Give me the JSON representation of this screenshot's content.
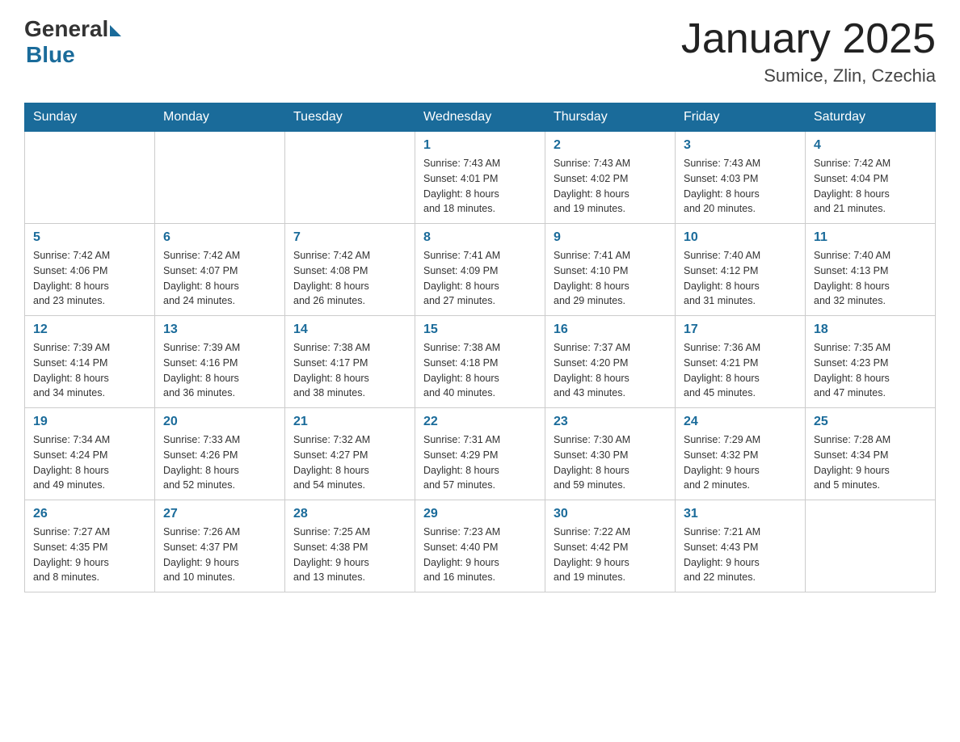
{
  "header": {
    "logo_general": "General",
    "logo_blue": "Blue",
    "month_title": "January 2025",
    "location": "Sumice, Zlin, Czechia"
  },
  "days_of_week": [
    "Sunday",
    "Monday",
    "Tuesday",
    "Wednesday",
    "Thursday",
    "Friday",
    "Saturday"
  ],
  "weeks": [
    [
      {
        "day": "",
        "info": ""
      },
      {
        "day": "",
        "info": ""
      },
      {
        "day": "",
        "info": ""
      },
      {
        "day": "1",
        "info": "Sunrise: 7:43 AM\nSunset: 4:01 PM\nDaylight: 8 hours\nand 18 minutes."
      },
      {
        "day": "2",
        "info": "Sunrise: 7:43 AM\nSunset: 4:02 PM\nDaylight: 8 hours\nand 19 minutes."
      },
      {
        "day": "3",
        "info": "Sunrise: 7:43 AM\nSunset: 4:03 PM\nDaylight: 8 hours\nand 20 minutes."
      },
      {
        "day": "4",
        "info": "Sunrise: 7:42 AM\nSunset: 4:04 PM\nDaylight: 8 hours\nand 21 minutes."
      }
    ],
    [
      {
        "day": "5",
        "info": "Sunrise: 7:42 AM\nSunset: 4:06 PM\nDaylight: 8 hours\nand 23 minutes."
      },
      {
        "day": "6",
        "info": "Sunrise: 7:42 AM\nSunset: 4:07 PM\nDaylight: 8 hours\nand 24 minutes."
      },
      {
        "day": "7",
        "info": "Sunrise: 7:42 AM\nSunset: 4:08 PM\nDaylight: 8 hours\nand 26 minutes."
      },
      {
        "day": "8",
        "info": "Sunrise: 7:41 AM\nSunset: 4:09 PM\nDaylight: 8 hours\nand 27 minutes."
      },
      {
        "day": "9",
        "info": "Sunrise: 7:41 AM\nSunset: 4:10 PM\nDaylight: 8 hours\nand 29 minutes."
      },
      {
        "day": "10",
        "info": "Sunrise: 7:40 AM\nSunset: 4:12 PM\nDaylight: 8 hours\nand 31 minutes."
      },
      {
        "day": "11",
        "info": "Sunrise: 7:40 AM\nSunset: 4:13 PM\nDaylight: 8 hours\nand 32 minutes."
      }
    ],
    [
      {
        "day": "12",
        "info": "Sunrise: 7:39 AM\nSunset: 4:14 PM\nDaylight: 8 hours\nand 34 minutes."
      },
      {
        "day": "13",
        "info": "Sunrise: 7:39 AM\nSunset: 4:16 PM\nDaylight: 8 hours\nand 36 minutes."
      },
      {
        "day": "14",
        "info": "Sunrise: 7:38 AM\nSunset: 4:17 PM\nDaylight: 8 hours\nand 38 minutes."
      },
      {
        "day": "15",
        "info": "Sunrise: 7:38 AM\nSunset: 4:18 PM\nDaylight: 8 hours\nand 40 minutes."
      },
      {
        "day": "16",
        "info": "Sunrise: 7:37 AM\nSunset: 4:20 PM\nDaylight: 8 hours\nand 43 minutes."
      },
      {
        "day": "17",
        "info": "Sunrise: 7:36 AM\nSunset: 4:21 PM\nDaylight: 8 hours\nand 45 minutes."
      },
      {
        "day": "18",
        "info": "Sunrise: 7:35 AM\nSunset: 4:23 PM\nDaylight: 8 hours\nand 47 minutes."
      }
    ],
    [
      {
        "day": "19",
        "info": "Sunrise: 7:34 AM\nSunset: 4:24 PM\nDaylight: 8 hours\nand 49 minutes."
      },
      {
        "day": "20",
        "info": "Sunrise: 7:33 AM\nSunset: 4:26 PM\nDaylight: 8 hours\nand 52 minutes."
      },
      {
        "day": "21",
        "info": "Sunrise: 7:32 AM\nSunset: 4:27 PM\nDaylight: 8 hours\nand 54 minutes."
      },
      {
        "day": "22",
        "info": "Sunrise: 7:31 AM\nSunset: 4:29 PM\nDaylight: 8 hours\nand 57 minutes."
      },
      {
        "day": "23",
        "info": "Sunrise: 7:30 AM\nSunset: 4:30 PM\nDaylight: 8 hours\nand 59 minutes."
      },
      {
        "day": "24",
        "info": "Sunrise: 7:29 AM\nSunset: 4:32 PM\nDaylight: 9 hours\nand 2 minutes."
      },
      {
        "day": "25",
        "info": "Sunrise: 7:28 AM\nSunset: 4:34 PM\nDaylight: 9 hours\nand 5 minutes."
      }
    ],
    [
      {
        "day": "26",
        "info": "Sunrise: 7:27 AM\nSunset: 4:35 PM\nDaylight: 9 hours\nand 8 minutes."
      },
      {
        "day": "27",
        "info": "Sunrise: 7:26 AM\nSunset: 4:37 PM\nDaylight: 9 hours\nand 10 minutes."
      },
      {
        "day": "28",
        "info": "Sunrise: 7:25 AM\nSunset: 4:38 PM\nDaylight: 9 hours\nand 13 minutes."
      },
      {
        "day": "29",
        "info": "Sunrise: 7:23 AM\nSunset: 4:40 PM\nDaylight: 9 hours\nand 16 minutes."
      },
      {
        "day": "30",
        "info": "Sunrise: 7:22 AM\nSunset: 4:42 PM\nDaylight: 9 hours\nand 19 minutes."
      },
      {
        "day": "31",
        "info": "Sunrise: 7:21 AM\nSunset: 4:43 PM\nDaylight: 9 hours\nand 22 minutes."
      },
      {
        "day": "",
        "info": ""
      }
    ]
  ]
}
